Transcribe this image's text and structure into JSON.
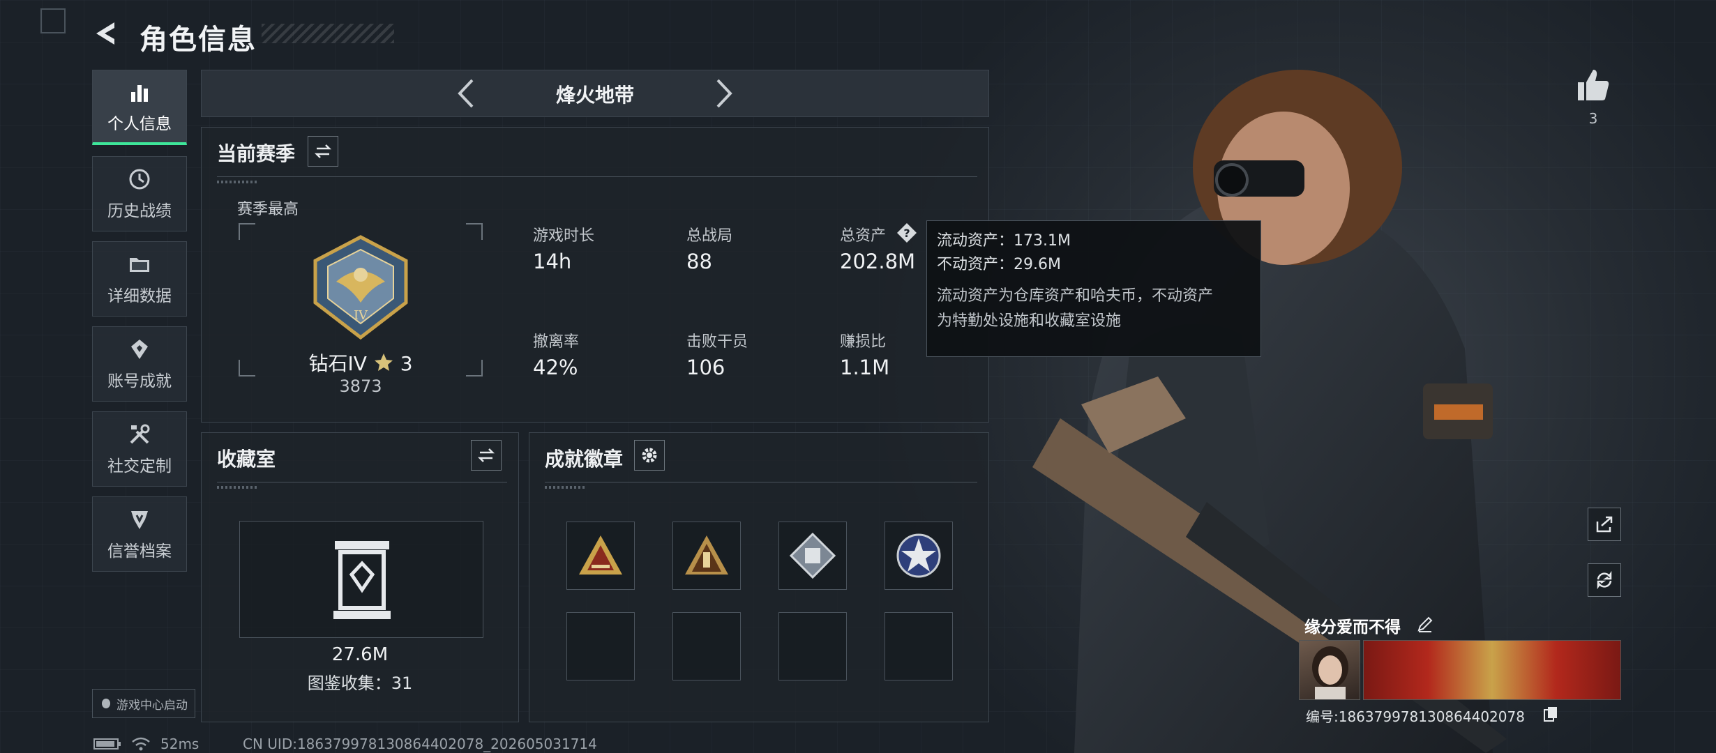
{
  "header": {
    "title": "角色信息"
  },
  "sidebar": {
    "items": [
      {
        "label": "个人信息",
        "icon": "bar-chart-icon",
        "active": true
      },
      {
        "label": "历史战绩",
        "icon": "clock-icon",
        "active": false
      },
      {
        "label": "详细数据",
        "icon": "folder-icon",
        "active": false
      },
      {
        "label": "账号成就",
        "icon": "achievement-icon",
        "active": false
      },
      {
        "label": "社交定制",
        "icon": "tools-icon",
        "active": false
      },
      {
        "label": "信誉档案",
        "icon": "credit-icon",
        "active": false
      }
    ],
    "game_center": "游戏中心启动"
  },
  "map_selector": {
    "title": "烽火地带"
  },
  "season": {
    "title": "当前赛季",
    "best_label": "赛季最高",
    "rank_name": "钻石IV",
    "rank_stars": "3",
    "rank_score": "3873",
    "stats": [
      {
        "label": "游戏时长",
        "value": "14h"
      },
      {
        "label": "总战局",
        "value": "88"
      },
      {
        "label": "总资产",
        "value": "202.8M"
      },
      {
        "label": "撤离率",
        "value": "42%"
      },
      {
        "label": "击败干员",
        "value": "106"
      },
      {
        "label": "赚损比",
        "value": "1.1M"
      }
    ]
  },
  "tooltip": {
    "liquid": "流动资产：173.1M",
    "fixed": "不动资产：29.6M",
    "desc_line1": "流动资产为仓库资产和哈夫币，不动资产",
    "desc_line2": "为特勤处设施和收藏室设施"
  },
  "collection": {
    "title": "收藏室",
    "value": "27.6M",
    "codex": "图鉴收集：31"
  },
  "badges": {
    "title": "成就徽章"
  },
  "profile": {
    "likes": "3",
    "player_name": "缘分爱而不得",
    "player_id": "编号:186379978130864402078"
  },
  "status_bar": {
    "ping": "52ms",
    "uid": "CN UID:186379978130864402078_202605031714"
  },
  "colors": {
    "accent": "#3ee69a",
    "panel_bg": "#1e242a",
    "gold": "#c9a24a"
  }
}
